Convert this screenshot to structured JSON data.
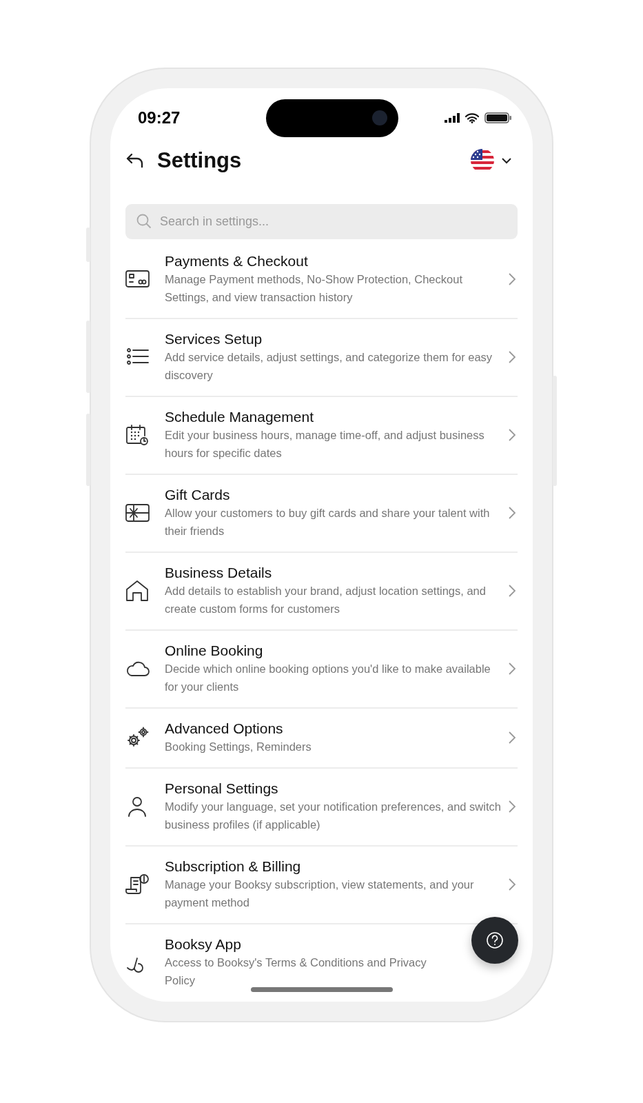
{
  "status_bar": {
    "time": "09:27"
  },
  "header": {
    "title": "Settings"
  },
  "search": {
    "placeholder": "Search in settings..."
  },
  "items": [
    {
      "title": "Payments & Checkout",
      "description": "Manage Payment methods, No-Show Protection, Checkout Settings, and view transaction history"
    },
    {
      "title": "Services Setup",
      "description": "Add service details, adjust settings, and categorize them for easy discovery"
    },
    {
      "title": "Schedule Management",
      "description": "Edit your business hours, manage time-off, and adjust business hours for specific dates"
    },
    {
      "title": "Gift Cards",
      "description": "Allow your customers to buy gift cards and share your talent with their friends"
    },
    {
      "title": "Business Details",
      "description": "Add details to establish your brand, adjust location settings, and create custom forms for customers"
    },
    {
      "title": "Online Booking",
      "description": "Decide which online booking options you'd like to make available for your clients"
    },
    {
      "title": "Advanced Options",
      "description": "Booking Settings, Reminders"
    },
    {
      "title": "Personal Settings",
      "description": "Modify your language, set your notification preferences, and switch business profiles (if applicable)"
    },
    {
      "title": "Subscription & Billing",
      "description": "Manage your Booksy subscription, view statements, and your payment method"
    },
    {
      "title": "Booksy App",
      "description": "Access to Booksy's Terms & Conditions and Privacy Policy"
    }
  ]
}
